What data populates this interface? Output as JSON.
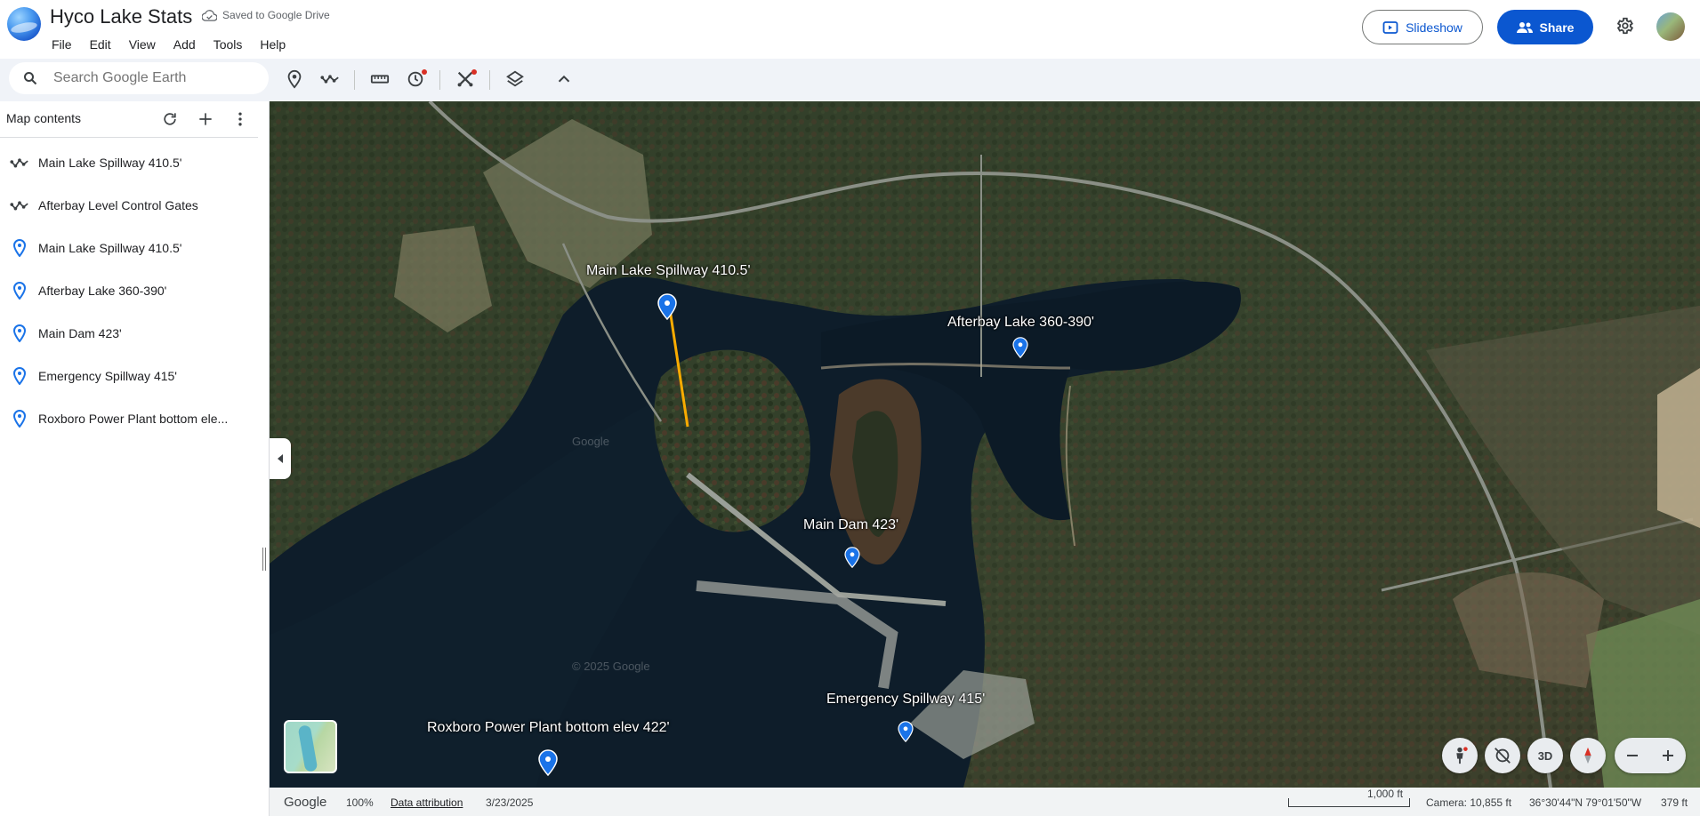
{
  "header": {
    "title": "Hyco Lake Stats",
    "drive_status": "Saved to Google Drive",
    "menu": [
      "File",
      "Edit",
      "View",
      "Add",
      "Tools",
      "Help"
    ],
    "slideshow_label": "Slideshow",
    "share_label": "Share"
  },
  "toolbar": {
    "search_placeholder": "Search Google Earth"
  },
  "sidebar": {
    "title": "Map contents",
    "items": [
      {
        "type": "path",
        "label": "Main Lake Spillway 410.5'"
      },
      {
        "type": "path",
        "label": "Afterbay Level Control Gates"
      },
      {
        "type": "placemark",
        "label": "Main Lake Spillway 410.5'"
      },
      {
        "type": "placemark",
        "label": "Afterbay Lake 360-390'"
      },
      {
        "type": "placemark",
        "label": "Main Dam 423'"
      },
      {
        "type": "placemark",
        "label": "Emergency Spillway 415'"
      },
      {
        "type": "placemark",
        "label": "Roxboro Power Plant bottom ele..."
      }
    ]
  },
  "map": {
    "labels": {
      "spillway": "Main Lake Spillway 410.5'",
      "afterbay": "Afterbay Lake 360-390'",
      "main_dam": "Main Dam 423'",
      "emergency": "Emergency Spillway 415'",
      "roxboro": "Roxboro Power Plant bottom elev 422'"
    },
    "watermark": "© 2025 Google",
    "watermark_small": "Google",
    "btn_3d": "3D",
    "pin_color": "#1a73e8",
    "path_color": "#f9ab00"
  },
  "statusbar": {
    "brand": "Google",
    "zoom": "100%",
    "attribution": "Data attribution",
    "date": "3/23/2025",
    "scale": "1,000 ft",
    "camera": "Camera: 10,855 ft",
    "coords": "36°30'44\"N 79°01'50\"W",
    "elevation": "379 ft"
  }
}
